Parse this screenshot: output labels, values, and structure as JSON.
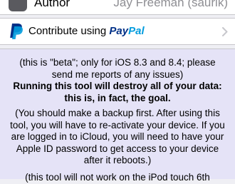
{
  "author_row": {
    "label": "Author",
    "value": "Jay Freeman (saurik)"
  },
  "paypal_row": {
    "prefix": "Contribute using ",
    "brand_pay": "Pay",
    "brand_pal": "Pal",
    "icon": "paypal-icon",
    "chevron": "chevron-right-icon"
  },
  "info": {
    "beta_note": "(this is \"beta\"; only for iOS 8.3 and 8.4; please send me reports of any issues)",
    "warning": "Running this tool will destroy all of your data: this is, in fact, the goal.",
    "backup": "(You should make a backup first. After using this tool, you will have to re-activate your device. If you are logged in to iCloud, you will need to have your Apple ID password to get access to your device after it reboots.)",
    "ipod_note": "(this tool will not work on the iPod touch 6th"
  },
  "colors": {
    "paypal_dark": "#003087",
    "paypal_light": "#009cde",
    "info_background": "#e5e3f7"
  }
}
